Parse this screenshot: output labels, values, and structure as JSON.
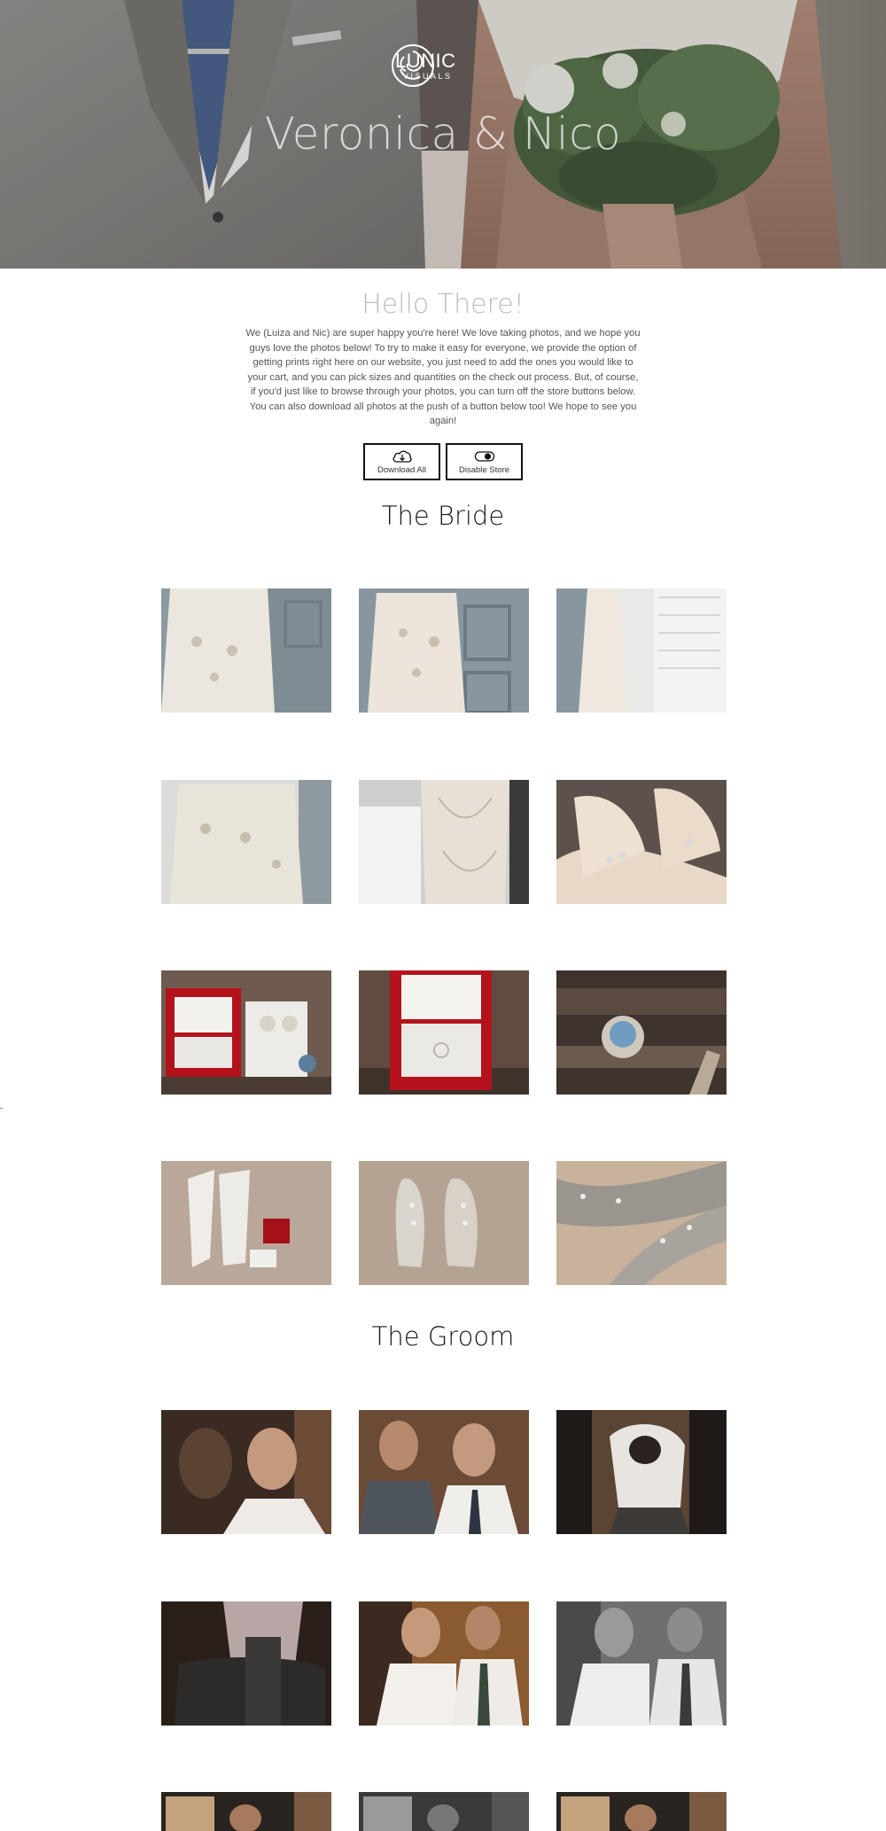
{
  "hero": {
    "title": "Veronica & Nico",
    "logo": {
      "name": "LUNIC",
      "sub": "VISUALS"
    }
  },
  "intro": {
    "title": "Hello There!",
    "text": "We (Luiza and Nic) are super happy you're here! We love taking photos, and we hope you guys love the photos below! To try to make it easy for everyone, we provide the option of getting prints right here on our website, you just need to add the ones you would like to your cart, and you can pick sizes and quantities on the check out process. But, of course, if you'd just like to browse through your photos, you can turn off the store buttons below. You can also download all photos at the push of a button below too! We hope to see you again!"
  },
  "buttons": {
    "download": {
      "label": "Download All",
      "icon": "cloud-download-icon"
    },
    "store": {
      "label": "Disable Store",
      "icon": "toggle-icon"
    }
  },
  "sections": {
    "bride": {
      "title": "The Bride"
    },
    "groom": {
      "title": "The Groom"
    }
  },
  "colors": {
    "text_dark": "#1a1a1a",
    "muted_title": "#bdbdbd",
    "button_border": "#111111"
  }
}
